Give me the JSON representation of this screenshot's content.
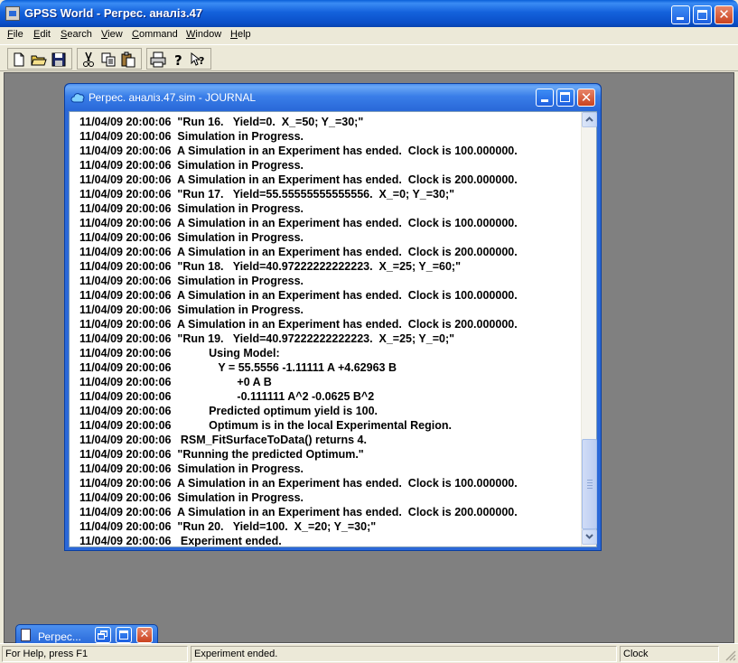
{
  "app": {
    "title": "GPSS World - Регрес. аналіз.47"
  },
  "menu": {
    "items": [
      {
        "label": "File"
      },
      {
        "label": "Edit"
      },
      {
        "label": "Search"
      },
      {
        "label": "View"
      },
      {
        "label": "Command"
      },
      {
        "label": "Window"
      },
      {
        "label": "Help"
      }
    ]
  },
  "toolbar": {
    "icons": [
      "new-document-icon",
      "open-folder-icon",
      "save-disk-icon",
      "cut-scissors-icon",
      "copy-icon",
      "paste-icon",
      "print-icon",
      "help-question-icon",
      "context-help-icon"
    ]
  },
  "journal": {
    "title": "Регрес. аналіз.47.sim  -  JOURNAL",
    "lines": [
      "11/04/09 20:00:06  \"Run 16.   Yield=0.  X_=50; Y_=30;\"",
      "11/04/09 20:00:06  Simulation in Progress.",
      "11/04/09 20:00:06  A Simulation in an Experiment has ended.  Clock is 100.000000.",
      "11/04/09 20:00:06  Simulation in Progress.",
      "11/04/09 20:00:06  A Simulation in an Experiment has ended.  Clock is 200.000000.",
      "11/04/09 20:00:06  \"Run 17.   Yield=55.55555555555556.  X_=0; Y_=30;\"",
      "11/04/09 20:00:06  Simulation in Progress.",
      "11/04/09 20:00:06  A Simulation in an Experiment has ended.  Clock is 100.000000.",
      "11/04/09 20:00:06  Simulation in Progress.",
      "11/04/09 20:00:06  A Simulation in an Experiment has ended.  Clock is 200.000000.",
      "11/04/09 20:00:06  \"Run 18.   Yield=40.97222222222223.  X_=25; Y_=60;\"",
      "11/04/09 20:00:06  Simulation in Progress.",
      "11/04/09 20:00:06  A Simulation in an Experiment has ended.  Clock is 100.000000.",
      "11/04/09 20:00:06  Simulation in Progress.",
      "11/04/09 20:00:06  A Simulation in an Experiment has ended.  Clock is 200.000000.",
      "11/04/09 20:00:06  \"Run 19.   Yield=40.97222222222223.  X_=25; Y_=0;\"",
      "11/04/09 20:00:06            Using Model:",
      "11/04/09 20:00:06               Y = 55.5556 -1.11111 A +4.62963 B",
      "11/04/09 20:00:06                     +0 A B",
      "11/04/09 20:00:06                     -0.111111 A^2 -0.0625 B^2",
      "11/04/09 20:00:06            Predicted optimum yield is 100.",
      "11/04/09 20:00:06            Optimum is in the local Experimental Region.",
      "11/04/09 20:00:06   RSM_FitSurfaceToData() returns 4.",
      "11/04/09 20:00:06  \"Running the predicted Optimum.\"",
      "11/04/09 20:00:06  Simulation in Progress.",
      "11/04/09 20:00:06  A Simulation in an Experiment has ended.  Clock is 100.000000.",
      "11/04/09 20:00:06  Simulation in Progress.",
      "11/04/09 20:00:06  A Simulation in an Experiment has ended.  Clock is 200.000000.",
      "11/04/09 20:00:06  \"Run 20.   Yield=100.  X_=20; Y_=30;\"",
      "11/04/09 20:00:06   Experiment ended."
    ]
  },
  "minimized_window": {
    "title": "Регрес..."
  },
  "status": {
    "help": "For Help, press F1",
    "message": "Experiment ended.",
    "clock": "Clock"
  }
}
